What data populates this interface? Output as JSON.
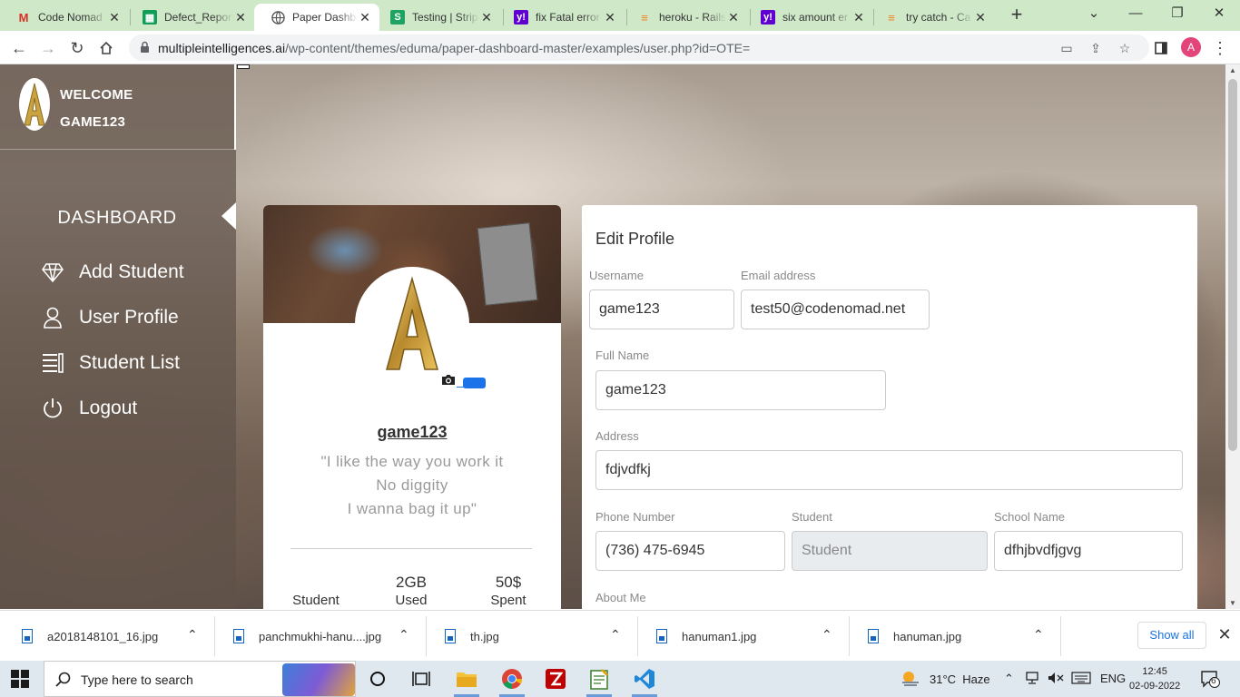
{
  "browser": {
    "tabs": [
      {
        "title": "Code Nomad",
        "icon": "gmail-icon",
        "active": false
      },
      {
        "title": "Defect_Report",
        "icon": "sheets-icon",
        "active": false
      },
      {
        "title": "Paper Dashboard",
        "icon": "globe-icon",
        "active": true
      },
      {
        "title": "Testing | Stripe",
        "icon": "stripe-icon",
        "active": false
      },
      {
        "title": "fix Fatal error",
        "icon": "yahoo-icon",
        "active": false
      },
      {
        "title": "heroku - Rails",
        "icon": "stackoverflow-icon",
        "active": false
      },
      {
        "title": "six amount er",
        "icon": "yahoo-icon",
        "active": false
      },
      {
        "title": "try catch - Ca",
        "icon": "stackoverflow-icon",
        "active": false
      }
    ],
    "url_host": "multipleintelligences.ai",
    "url_path": "/wp-content/themes/eduma/paper-dashboard-master/examples/user.php?id=OTE=",
    "profile_initial": "A"
  },
  "sidebar": {
    "welcome": "WELCOME",
    "username": "GAME123",
    "dashboard": "DASHBOARD",
    "items": [
      {
        "label": "Add Student",
        "icon": "diamond-icon"
      },
      {
        "label": "User Profile",
        "icon": "user-icon"
      },
      {
        "label": "Student List",
        "icon": "list-icon"
      },
      {
        "label": "Logout",
        "icon": "power-icon"
      }
    ]
  },
  "profile_card": {
    "name": "game123",
    "quote": [
      "\"I like the way you work it",
      "No diggity",
      "I wanna bag it up\""
    ],
    "stats": [
      {
        "value": "",
        "label": "Student"
      },
      {
        "value": "2GB",
        "label": "Used"
      },
      {
        "value": "50$",
        "label": "Spent"
      }
    ]
  },
  "edit_profile": {
    "title": "Edit Profile",
    "username": {
      "label": "Username",
      "value": "game123"
    },
    "email": {
      "label": "Email address",
      "value": "test50@codenomad.net"
    },
    "full_name": {
      "label": "Full Name",
      "value": "game123"
    },
    "address": {
      "label": "Address",
      "value": "fdjvdfkj"
    },
    "phone": {
      "label": "Phone Number",
      "value": "(736) 475-6945"
    },
    "student": {
      "label": "Student",
      "value": "Student"
    },
    "school": {
      "label": "School Name",
      "value": "dfhjbvdfjgvg"
    },
    "about_label": "About Me"
  },
  "downloads": {
    "files": [
      "a2018148101_16.jpg",
      "panchmukhi-hanu....jpg",
      "th.jpg",
      "hanuman1.jpg",
      "hanuman.jpg"
    ],
    "show_all": "Show all"
  },
  "taskbar": {
    "search_placeholder": "Type here to search",
    "temperature": "31°C",
    "weather": "Haze",
    "language": "ENG",
    "time": "12:45",
    "date": "02-09-2022",
    "notifications": "6"
  }
}
